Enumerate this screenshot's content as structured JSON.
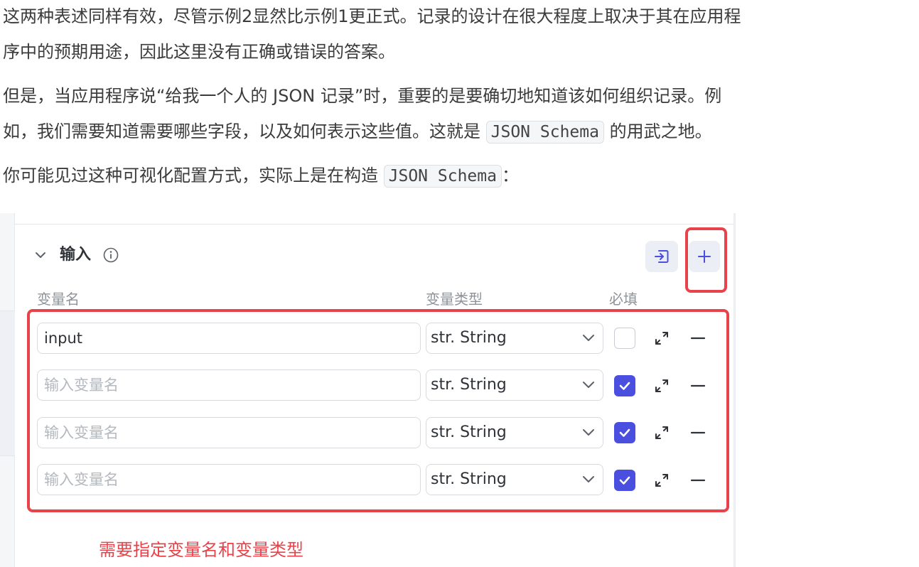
{
  "article": {
    "para1_line1": "这两种表述同样有效，尽管示例2显然比示例1更正式。记录的设计在很大程度上取决于其在应用程",
    "para1_line2": "序中的预期用途，因此这里没有正确或错误的答案。",
    "para2_line1": "但是，当应用程序说“给我一个人的 JSON 记录”时，重要的是要确切地知道该如何组织记录。例",
    "para2_line2_pre": "如，我们需要知道需要哪些字段，以及如何表示这些值。这就是 ",
    "para2_code": "JSON Schema",
    "para2_line2_post": " 的用武之地。",
    "para3_pre": "你可能见过这种可视化配置方式，实际上是在构造 ",
    "para3_code": "JSON Schema",
    "para3_post": "："
  },
  "panel": {
    "title": "输入",
    "columns": {
      "name": "变量名",
      "type": "变量类型",
      "required": "必填"
    },
    "rows": [
      {
        "value": "input",
        "placeholder": "",
        "type_label": "str. String",
        "required": false
      },
      {
        "value": "",
        "placeholder": "输入变量名",
        "type_label": "str. String",
        "required": true
      },
      {
        "value": "",
        "placeholder": "输入变量名",
        "type_label": "str. String",
        "required": true
      },
      {
        "value": "",
        "placeholder": "输入变量名",
        "type_label": "str. String",
        "required": true
      }
    ],
    "annotation": "需要指定变量名和变量类型",
    "accent_color": "#4a4fe0",
    "highlight_color": "#e8434a"
  }
}
